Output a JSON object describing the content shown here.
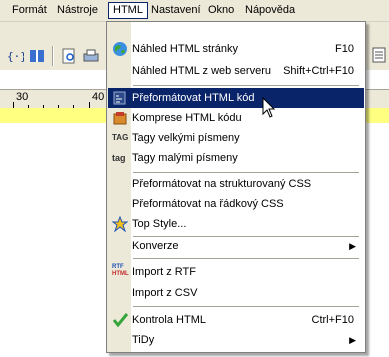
{
  "menubar": {
    "items": [
      {
        "label": "Formát"
      },
      {
        "label": "Nástroje"
      },
      {
        "label": "HTML"
      },
      {
        "label": "Nastavení"
      },
      {
        "label": "Okno"
      },
      {
        "label": "Nápověda"
      }
    ]
  },
  "ruler": {
    "labels": [
      "30",
      "40"
    ]
  },
  "html_menu": {
    "items": [
      {
        "label": "Náhled HTML stránky",
        "shortcut": "F10",
        "icon": "globe-icon"
      },
      {
        "label": "Náhled HTML z web serveru",
        "shortcut": "Shift+Ctrl+F10"
      },
      {
        "label": "Přeformátovat HTML kód",
        "icon": "format-code-icon"
      },
      {
        "label": "Komprese HTML kódu",
        "icon": "compress-icon"
      },
      {
        "label": "Tagy velkými písmeny",
        "icon": "tag-uppercase-icon"
      },
      {
        "label": "Tagy malými písmeny",
        "icon": "tag-lowercase-icon"
      },
      {
        "label": "Přeformátovat na strukturovaný CSS"
      },
      {
        "label": "Přeformátovat na řádkový CSS"
      },
      {
        "label": "Top Style...",
        "icon": "topstyle-icon"
      },
      {
        "label": "Konverze",
        "submenu": true
      },
      {
        "label": "Import z RTF",
        "icon": "rtf-html-icon"
      },
      {
        "label": "Import z CSV"
      },
      {
        "label": "Kontrola HTML",
        "shortcut": "Ctrl+F10",
        "icon": "checkmark-icon"
      },
      {
        "label": "TiDy",
        "submenu": true
      }
    ],
    "highlighted_index": 2,
    "highlight_color": "#0a246a"
  },
  "icon_glyphs": {
    "tag_upper": "TAG",
    "tag_lower": "tag",
    "rtf": "RTF",
    "html": "HTML",
    "submenu_arrow": "▶"
  }
}
